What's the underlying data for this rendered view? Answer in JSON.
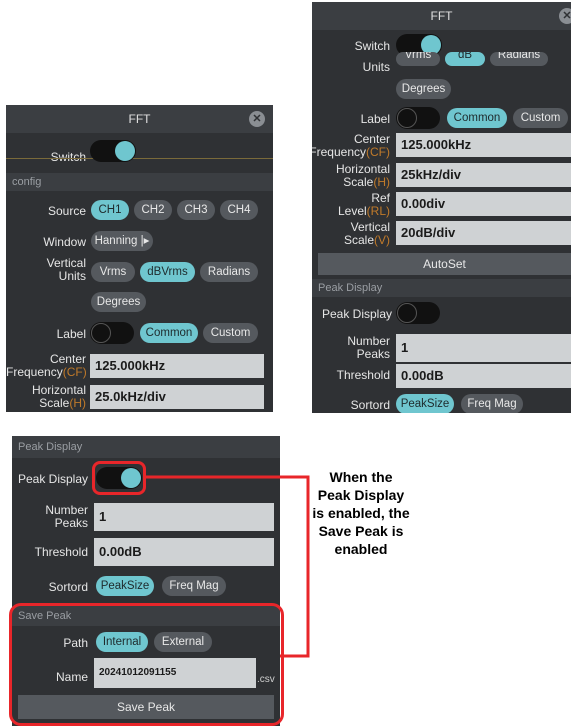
{
  "panel1": {
    "title": "FFT",
    "switch_label": "Switch",
    "config_header": "config",
    "source_label": "Source",
    "channels": [
      "CH1",
      "CH2",
      "CH3",
      "CH4"
    ],
    "window_label": "Window",
    "window_value": "Hanning",
    "vertical_units_label": [
      "Vertical",
      "Units"
    ],
    "units": [
      "Vrms",
      "dBVrms",
      "Radians",
      "Degrees"
    ],
    "label_label": "Label",
    "label_options": [
      "Common",
      "Custom"
    ],
    "center_freq_label": [
      "Center",
      "Frequency",
      "(CF)"
    ],
    "center_freq_value": "125.000kHz",
    "horiz_scale_label": [
      "Horizontal",
      "Scale",
      "(H)"
    ],
    "horiz_scale_value": "25.0kHz/div"
  },
  "panel2": {
    "title": "FFT",
    "switch_label": "Switch",
    "units_label": "Units",
    "units_partial": [
      "Vrms",
      "dB",
      "Radians"
    ],
    "degrees": "Degrees",
    "label_label": "Label",
    "label_options": [
      "Common",
      "Custom"
    ],
    "center_freq_label": [
      "Center",
      "Frequency",
      "(CF)"
    ],
    "center_freq_value": "125.000kHz",
    "horiz_scale_label": [
      "Horizontal",
      "Scale",
      "(H)"
    ],
    "horiz_scale_value": "25kHz/div",
    "ref_level_label": [
      "Ref",
      "Level",
      "(RL)"
    ],
    "ref_level_value": "0.00div",
    "vert_scale_label": [
      "Vertical",
      "Scale",
      "(V)"
    ],
    "vert_scale_value": "20dB/div",
    "autoset": "AutoSet",
    "peak_display_header": "Peak Display",
    "peak_display_label": "Peak Display",
    "number_peaks_label": [
      "Number",
      "Peaks"
    ],
    "number_peaks_value": "1",
    "threshold_label": "Threshold",
    "threshold_value": "0.00dB",
    "sortord_label": "Sortord",
    "sortord_options": [
      "PeakSize",
      "Freq Mag"
    ]
  },
  "panel3": {
    "peak_display_header": "Peak Display",
    "peak_display_label": "Peak Display",
    "number_peaks_label": [
      "Number",
      "Peaks"
    ],
    "number_peaks_value": "1",
    "threshold_label": "Threshold",
    "threshold_value": "0.00dB",
    "sortord_label": "Sortord",
    "sortord_options": [
      "PeakSize",
      "Freq Mag"
    ],
    "save_peak_header": "Save Peak",
    "path_label": "Path",
    "path_options": [
      "Internal",
      "External"
    ],
    "name_label": "Name",
    "name_value": "20241012091155",
    "name_ext": ".csv",
    "save_button": "Save Peak"
  },
  "annotation": "When the Peak Display  is enabled, the Save Peak is enabled",
  "colors": {
    "accent": "#6fc6cf",
    "highlight": "#e8262a",
    "panel": "#2f3134",
    "subtext": "#c07a2a"
  }
}
